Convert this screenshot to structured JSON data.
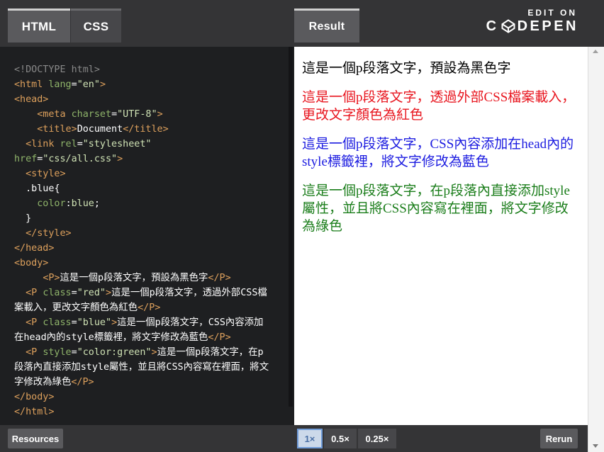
{
  "tabs": {
    "html": "HTML",
    "css": "CSS",
    "result": "Result"
  },
  "brand": {
    "edit_on": "EDIT ON",
    "codepen_left": "C",
    "codepen_right": "DEPEN"
  },
  "code_lines": [
    [
      {
        "t": "<!DOCTYPE html>",
        "c": "c-comment"
      }
    ],
    [
      {
        "t": "<html ",
        "c": "c-tag"
      },
      {
        "t": "lang",
        "c": "c-attr"
      },
      {
        "t": "=",
        "c": "c-punct"
      },
      {
        "t": "\"en\"",
        "c": "c-str"
      },
      {
        "t": ">",
        "c": "c-tag"
      }
    ],
    [
      {
        "t": "<head>",
        "c": "c-tag"
      }
    ],
    [
      {
        "t": "    <meta ",
        "c": "c-tag"
      },
      {
        "t": "charset",
        "c": "c-attr"
      },
      {
        "t": "=",
        "c": "c-punct"
      },
      {
        "t": "\"UTF-8\"",
        "c": "c-str"
      },
      {
        "t": ">",
        "c": "c-tag"
      }
    ],
    [
      {
        "t": "    <title>",
        "c": "c-tag"
      },
      {
        "t": "Document",
        "c": "c-sel"
      },
      {
        "t": "</title>",
        "c": "c-tag"
      }
    ],
    [
      {
        "t": "  <link ",
        "c": "c-tag"
      },
      {
        "t": "rel",
        "c": "c-attr"
      },
      {
        "t": "=",
        "c": "c-punct"
      },
      {
        "t": "\"stylesheet\"",
        "c": "c-str"
      }
    ],
    [
      {
        "t": "href",
        "c": "c-attr"
      },
      {
        "t": "=",
        "c": "c-punct"
      },
      {
        "t": "\"css/all.css\"",
        "c": "c-str"
      },
      {
        "t": ">",
        "c": "c-tag"
      }
    ],
    [
      {
        "t": "  <style>",
        "c": "c-tag"
      }
    ],
    [
      {
        "t": "  .blue",
        "c": "c-sel"
      },
      {
        "t": "{",
        "c": "c-punct"
      }
    ],
    [
      {
        "t": "    color",
        "c": "c-attr"
      },
      {
        "t": ":",
        "c": "c-punct"
      },
      {
        "t": "blue",
        "c": "c-str"
      },
      {
        "t": ";",
        "c": "c-punct"
      }
    ],
    [
      {
        "t": "  }",
        "c": "c-punct"
      }
    ],
    [
      {
        "t": "  </style>",
        "c": "c-tag"
      }
    ],
    [
      {
        "t": "</head>",
        "c": "c-tag"
      }
    ],
    [
      {
        "t": "<body>",
        "c": "c-tag"
      }
    ],
    [
      {
        "t": "     <P>",
        "c": "c-tag"
      },
      {
        "t": "這是一個p段落文字，預設為黑色字",
        "c": "c-sel"
      },
      {
        "t": "</P>",
        "c": "c-tag"
      }
    ],
    [
      {
        "t": "  <P ",
        "c": "c-tag"
      },
      {
        "t": "class",
        "c": "c-attr"
      },
      {
        "t": "=",
        "c": "c-punct"
      },
      {
        "t": "\"red\"",
        "c": "c-str"
      },
      {
        "t": ">",
        "c": "c-tag"
      },
      {
        "t": "這是一個p段落文字，透過外部CSS檔案載入，更改文字顏色為紅色",
        "c": "c-sel"
      },
      {
        "t": "</P>",
        "c": "c-tag"
      }
    ],
    [
      {
        "t": "  <P ",
        "c": "c-tag"
      },
      {
        "t": "class",
        "c": "c-attr"
      },
      {
        "t": "=",
        "c": "c-punct"
      },
      {
        "t": "\"blue\"",
        "c": "c-str"
      },
      {
        "t": ">",
        "c": "c-tag"
      },
      {
        "t": "這是一個p段落文字，CSS內容添加在head內的style標籤裡，將文字修改為藍色",
        "c": "c-sel"
      },
      {
        "t": "</P>",
        "c": "c-tag"
      }
    ],
    [
      {
        "t": "  <P ",
        "c": "c-tag"
      },
      {
        "t": "style",
        "c": "c-attr"
      },
      {
        "t": "=",
        "c": "c-punct"
      },
      {
        "t": "\"color:green\"",
        "c": "c-str"
      },
      {
        "t": ">",
        "c": "c-tag"
      },
      {
        "t": "這是一個p段落文字，在p段落內直接添加style屬性，並且將CSS內容寫在裡面，將文字修改為綠色",
        "c": "c-sel"
      },
      {
        "t": "</P>",
        "c": "c-tag"
      }
    ],
    [
      {
        "t": "</body>",
        "c": "c-tag"
      }
    ],
    [
      {
        "t": "</html>",
        "c": "c-tag"
      }
    ]
  ],
  "result": {
    "p_black": "這是一個p段落文字，預設為黑色字",
    "p_red": "這是一個p段落文字，透過外部CSS檔案載入，更改文字顏色為紅色",
    "p_blue": "這是一個p段落文字，CSS內容添加在head內的style標籤裡，將文字修改為藍色",
    "p_green": "這是一個p段落文字，在p段落內直接添加style屬性，並且將CSS內容寫在裡面，將文字修改為綠色"
  },
  "bottom": {
    "resources": "Resources",
    "zoom_1": "1×",
    "zoom_05": "0.5×",
    "zoom_025": "0.25×",
    "rerun": "Rerun",
    "active_zoom": "1×"
  },
  "colors": {
    "tag": "#dda05c",
    "attr": "#8fb46a",
    "string": "#cfe2b4",
    "red_text": "#e8151e",
    "blue_text": "#1b1be0",
    "green_text": "#1a7d1a"
  }
}
